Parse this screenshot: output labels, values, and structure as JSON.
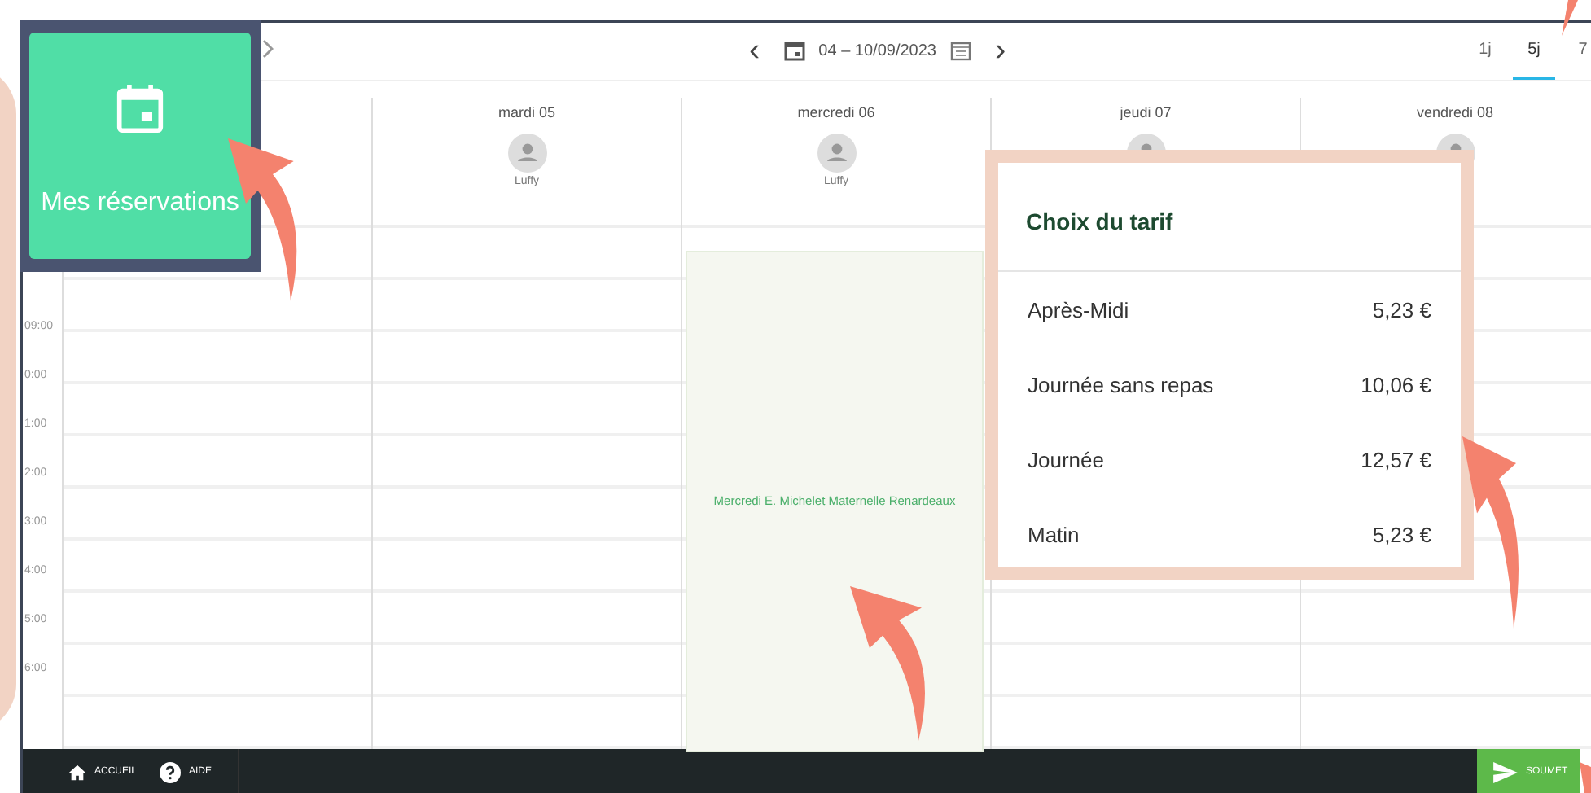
{
  "toolbar": {
    "prev": "‹",
    "range": "04 – 10/09/2023",
    "next": "›",
    "views": [
      {
        "label": "1j",
        "selected": false
      },
      {
        "label": "5j",
        "selected": true
      },
      {
        "label": "7",
        "selected": false
      }
    ]
  },
  "tile": {
    "label": "Mes réservations"
  },
  "days": [
    {
      "label": "mardi 05",
      "name": "Luffy"
    },
    {
      "label": "mercredi 06",
      "name": "Luffy",
      "event": "Mercredi E. Michelet Maternelle Renardeaux"
    },
    {
      "label": "jeudi 07"
    },
    {
      "label": "vendredi 08"
    }
  ],
  "hours": [
    "09:00",
    "0:00",
    "1:00",
    "2:00",
    "3:00",
    "4:00",
    "5:00",
    "6:00"
  ],
  "tarif": {
    "title": "Choix du tarif",
    "rows": [
      {
        "label": "Après-Midi",
        "price": "5,23 €"
      },
      {
        "label": "Journée sans repas",
        "price": "10,06 €"
      },
      {
        "label": "Journée",
        "price": "12,57 €"
      },
      {
        "label": "Matin",
        "price": "5,23 €"
      }
    ]
  },
  "bottom": {
    "home": "ACCUEIL",
    "help": "AIDE",
    "submit": "SOUMET"
  }
}
